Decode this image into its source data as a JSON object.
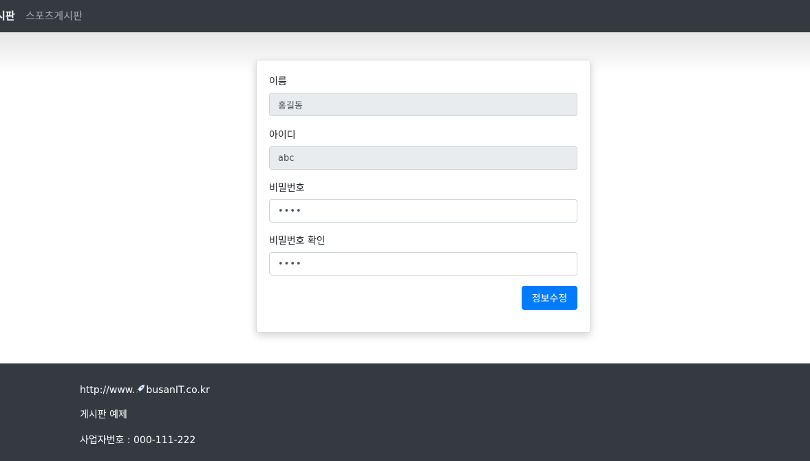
{
  "navbar": {
    "brand": "시판",
    "link": "스포츠게시판"
  },
  "form": {
    "name_label": "이름",
    "name_value": "홍길동",
    "id_label": "아이디",
    "id_value": "abc",
    "password_label": "비밀번호",
    "password_value": "••••",
    "password_confirm_label": "비밀번호 확인",
    "password_confirm_value": "••••",
    "submit_label": "정보수정"
  },
  "footer": {
    "url_prefix": "http://www.",
    "url_icon": "rocket-icon",
    "url_suffix": "busanIT.co.kr",
    "title": "게시판 예제",
    "business_number": "사업자번호 : 000-111-222"
  },
  "colors": {
    "navbar_bg": "#343a40",
    "primary": "#007bff",
    "readonly_bg": "#e9ecef"
  }
}
